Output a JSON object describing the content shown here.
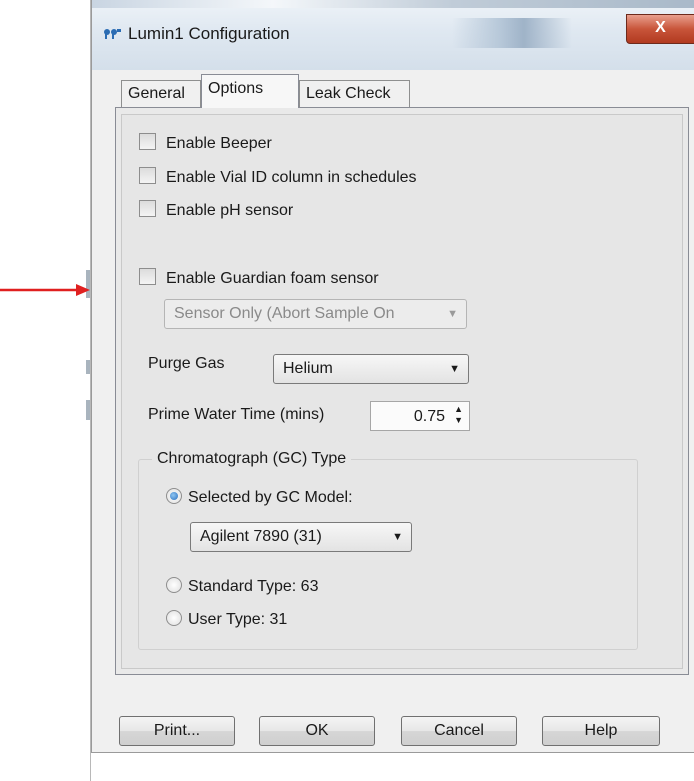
{
  "window": {
    "title": "Lumin1 Configuration",
    "close_glyph": "X"
  },
  "tabs": [
    {
      "label": "General",
      "active": false
    },
    {
      "label": "Options",
      "active": true
    },
    {
      "label": "Leak Check",
      "active": false
    }
  ],
  "options": {
    "checkboxes": [
      {
        "label": "Enable Beeper",
        "checked": false
      },
      {
        "label": "Enable Vial ID column in schedules",
        "checked": false
      },
      {
        "label": "Enable pH sensor",
        "checked": false
      },
      {
        "label": "Enable Guardian foam sensor",
        "checked": false
      }
    ],
    "foam_sensor_mode": {
      "value": "Sensor Only (Abort Sample On",
      "enabled": false
    },
    "purge_gas": {
      "label": "Purge Gas",
      "value": "Helium"
    },
    "prime_water": {
      "label": "Prime Water Time (mins)",
      "value": "0.75"
    },
    "gc_type": {
      "group_title": "Chromatograph (GC) Type",
      "selected_by_model": {
        "label": "Selected by GC Model:",
        "checked": true
      },
      "model": {
        "value": "Agilent 7890 (31)"
      },
      "standard_type": {
        "label": "Standard Type: 63",
        "checked": false
      },
      "user_type": {
        "label": "User Type: 31",
        "checked": false
      }
    }
  },
  "buttons": {
    "print": "Print...",
    "ok": "OK",
    "cancel": "Cancel",
    "help": "Help"
  },
  "colors": {
    "annotation_arrow": "#e02020",
    "radio_selected": "#2a6fbf"
  }
}
